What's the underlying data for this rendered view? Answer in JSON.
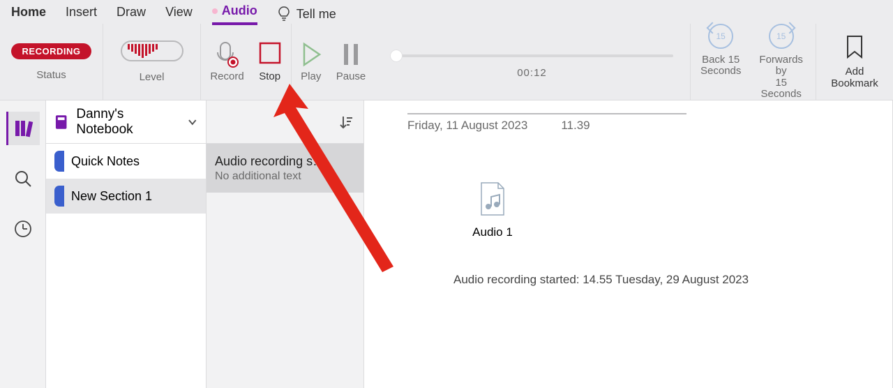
{
  "tabs": {
    "home": "Home",
    "insert": "Insert",
    "draw": "Draw",
    "view": "View",
    "audio": "Audio",
    "tellme": "Tell me"
  },
  "ribbon": {
    "status_badge": "RECORDING",
    "status_label": "Status",
    "level_label": "Level",
    "record": "Record",
    "stop": "Stop",
    "play": "Play",
    "pause": "Pause",
    "playback_time": "00:12",
    "back15_line1": "Back 15",
    "back15_line2": "Seconds",
    "fwd15_line1": "Forwards by",
    "fwd15_line2": "15 Seconds",
    "seek_glyph": "15",
    "bookmark_line1": "Add",
    "bookmark_line2": "Bookmark"
  },
  "notebook": {
    "name": "Danny's Notebook"
  },
  "sections": [
    {
      "label": "Quick Notes"
    },
    {
      "label": "New Section 1"
    }
  ],
  "pages": [
    {
      "title": "Audio recording s…",
      "sub": "No additional text"
    }
  ],
  "note": {
    "date": "Friday, 11 August 2023",
    "time": "11.39",
    "audio_filename": "Audio 1",
    "recording_started": "Audio recording started: 14.55 Tuesday, 29 August 2023"
  }
}
